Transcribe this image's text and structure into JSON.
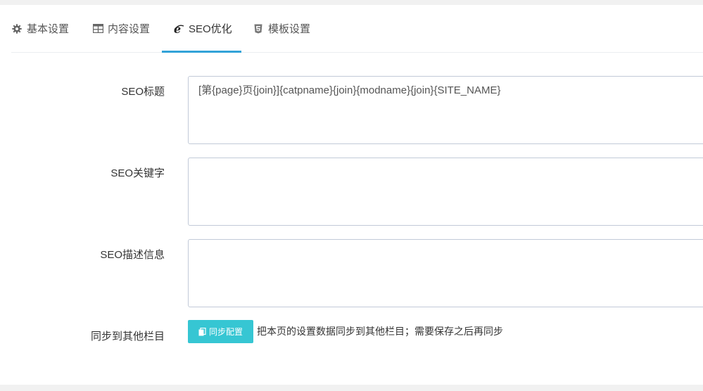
{
  "tabs": [
    {
      "label": "基本设置",
      "icon": "gear-icon"
    },
    {
      "label": "内容设置",
      "icon": "table-icon"
    },
    {
      "label": "SEO优化",
      "icon": "ie-icon",
      "active": true
    },
    {
      "label": "模板设置",
      "icon": "html5-icon"
    }
  ],
  "form": {
    "seo_title": {
      "label": "SEO标题",
      "value": "[第{page}页{join}]{catpname}{join}{modname}{join}{SITE_NAME}"
    },
    "seo_keywords": {
      "label": "SEO关键字",
      "value": ""
    },
    "seo_description": {
      "label": "SEO描述信息",
      "value": ""
    },
    "sync": {
      "label": "同步到其他栏目",
      "button_label": "同步配置",
      "button_icon": "copy-icon",
      "help": "把本页的设置数据同步到其他栏目；需要保存之后再同步"
    }
  },
  "colors": {
    "accent": "#32a3d8",
    "button": "#36c6d3"
  }
}
